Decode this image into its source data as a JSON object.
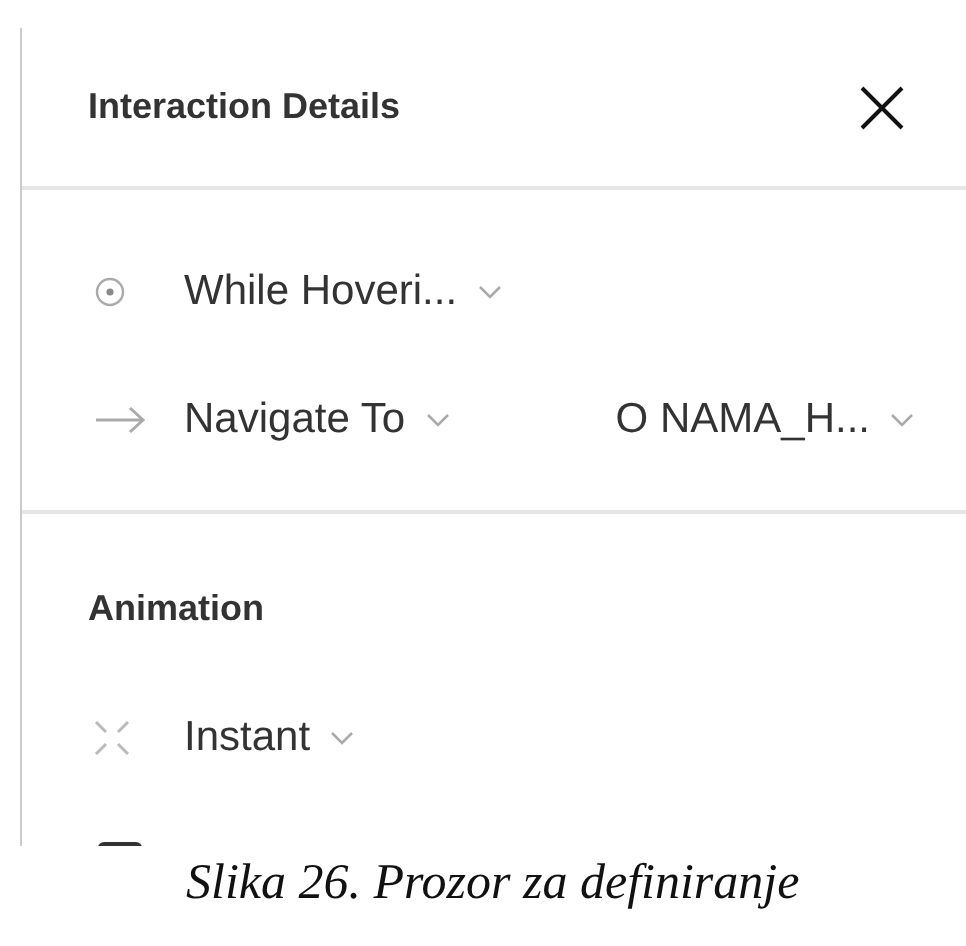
{
  "panel": {
    "title": "Interaction Details",
    "rows": [
      {
        "kind": "trigger",
        "label": "While Hoveri...",
        "target": null
      },
      {
        "kind": "action",
        "label": "Navigate To",
        "target": "O NAMA_H..."
      }
    ],
    "animation": {
      "title": "Animation",
      "rows": [
        {
          "kind": "animation",
          "label": "Instant"
        }
      ]
    }
  },
  "caption": "Slika 26. Prozor za definiranje"
}
